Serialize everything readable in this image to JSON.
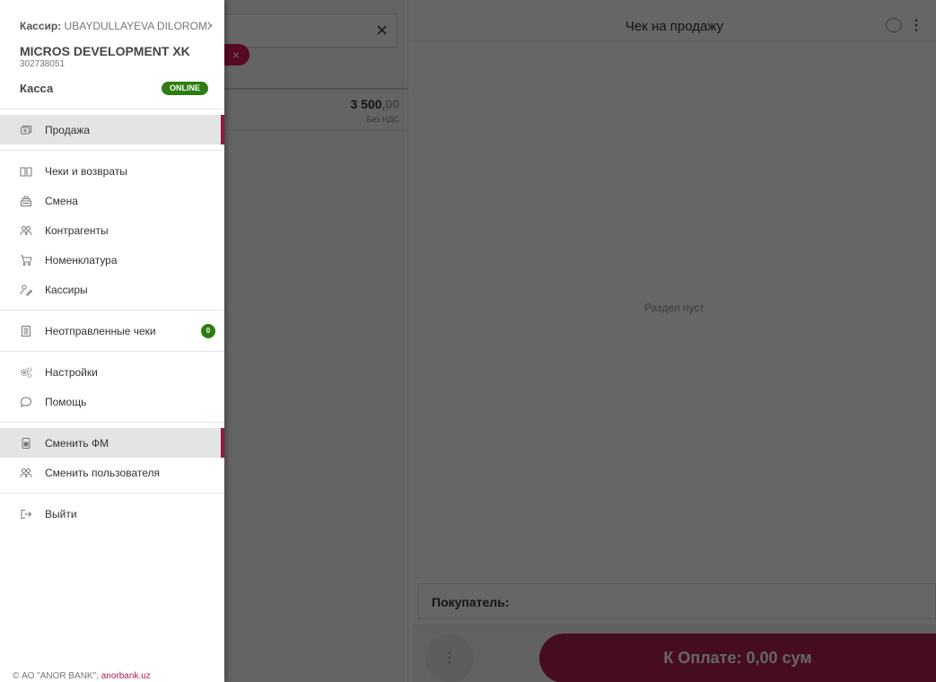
{
  "drawer": {
    "cashier_label": "Кассир:",
    "cashier_name": "UBAYDULLAYEVA DILOROMX",
    "company_name": "MICROS DEVELOPMENT XK",
    "company_id": "302738051",
    "kassa_label": "Касса",
    "status": "ONLINE",
    "menu": {
      "sale": "Продажа",
      "receipts": "Чеки и возвраты",
      "shift": "Смена",
      "counterparties": "Контрагенты",
      "nomenclature": "Номенклатура",
      "cashiers": "Кассиры",
      "unsent": "Неотправленные чеки",
      "unsent_count": "0",
      "settings": "Настройки",
      "help": "Помощь",
      "change_fm": "Сменить ФМ",
      "change_user": "Сменить пользователя",
      "logout": "Выйти"
    },
    "footer_text": "© АО \"ANOR BANK\", ",
    "footer_link": "anorbank.uz"
  },
  "left_pane": {
    "search_close": "×",
    "chip_close": "×",
    "product_price_main": "3 500",
    "product_price_cents": ",00",
    "product_vat": "Без НДС"
  },
  "receipt": {
    "title": "Чек на продажу",
    "empty_text": "Раздел пуст",
    "buyer_label": "Покупатель:",
    "more_button": "⋮",
    "pay_button": "К Оплате: 0,00 сум"
  },
  "colors": {
    "accent": "#b01e4e",
    "online": "#2e7d12",
    "active_marker": "#8e1b43"
  }
}
